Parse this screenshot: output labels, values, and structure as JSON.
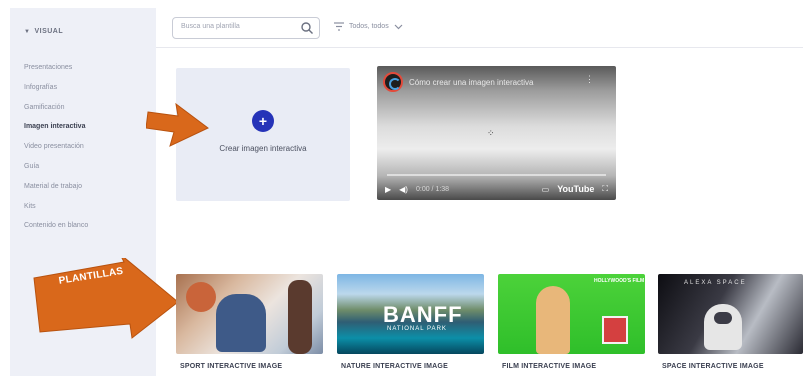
{
  "sidebar": {
    "header": "VISUAL",
    "items": [
      {
        "label": "Presentaciones",
        "active": false
      },
      {
        "label": "Infografías",
        "active": false
      },
      {
        "label": "Gamificación",
        "active": false
      },
      {
        "label": "Imagen interactiva",
        "active": true
      },
      {
        "label": "Video presentación",
        "active": false
      },
      {
        "label": "Guía",
        "active": false
      },
      {
        "label": "Material de trabajo",
        "active": false
      },
      {
        "label": "Kits",
        "active": false
      },
      {
        "label": "Contenido en blanco",
        "active": false
      }
    ]
  },
  "topbar": {
    "search_placeholder": "Busca una plantilla",
    "filter_label": "Todos, todos"
  },
  "create_card": {
    "label": "Crear imagen interactiva"
  },
  "video": {
    "title": "Cómo crear una imagen interactiva",
    "time": "0:00 / 1:38",
    "brand": "YouTube"
  },
  "annotations": {
    "templates_label": "PLANTILLAS"
  },
  "templates": [
    {
      "label": "SPORT INTERACTIVE IMAGE"
    },
    {
      "label": "NATURE INTERACTIVE IMAGE",
      "thumb_text": "BANFF",
      "thumb_subtext": "NATIONAL PARK"
    },
    {
      "label": "FILM INTERACTIVE IMAGE",
      "thumb_text": "HOLLYWOOD'S FILM"
    },
    {
      "label": "SPACE INTERACTIVE IMAGE",
      "thumb_text": "ALEXA SPACE"
    }
  ],
  "colors": {
    "accent": "#2533b8",
    "arrow": "#d9681b",
    "sidebar_bg": "#eef0f7",
    "card_bg": "#e9ecf5"
  }
}
